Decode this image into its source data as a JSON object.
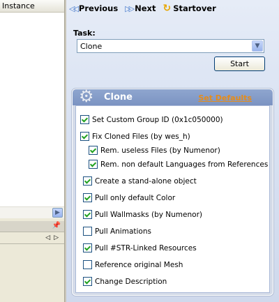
{
  "left_pane": {
    "column_header": "Instance",
    "scroll_right_glyph": "▶",
    "pin_glyph": "📌",
    "prev_glyph": "◁",
    "next_glyph": "▷"
  },
  "toolbar": {
    "previous_label": "Previous",
    "next_label": "Next",
    "startover_label": "Startover",
    "arrow_glyph": "◁◁",
    "arrow_next_glyph": "▷▷",
    "startover_glyph": "↻"
  },
  "task": {
    "label": "Task:",
    "selected": "Clone",
    "dropdown_glyph": "▼",
    "start_label": "Start"
  },
  "clone_panel": {
    "title": "Clone",
    "set_defaults_label": "Set Defaults",
    "gear_glyph": "⚙",
    "options": [
      {
        "label": "Set Custom Group ID (0x1c050000)",
        "checked": true
      },
      {
        "label": "Fix Cloned Files (by wes_h)",
        "checked": true
      },
      {
        "label": "Rem. useless Files (by  Numenor)",
        "checked": true
      },
      {
        "label": "Rem. non default Languages from References",
        "checked": true
      },
      {
        "label": "Create a stand-alone object",
        "checked": true
      },
      {
        "label": "Pull only default Color",
        "checked": true
      },
      {
        "label": "Pull Wallmasks (by Numenor)",
        "checked": true
      },
      {
        "label": "Pull Animations",
        "checked": false
      },
      {
        "label": "Pull #STR-Linked Resources",
        "checked": true
      },
      {
        "label": "Reference original Mesh",
        "checked": false
      },
      {
        "label": "Change Description",
        "checked": true
      }
    ]
  },
  "colors": {
    "accent_blue": "#3e74c9",
    "link_orange": "#e58c1a",
    "check_green": "#21a121"
  }
}
